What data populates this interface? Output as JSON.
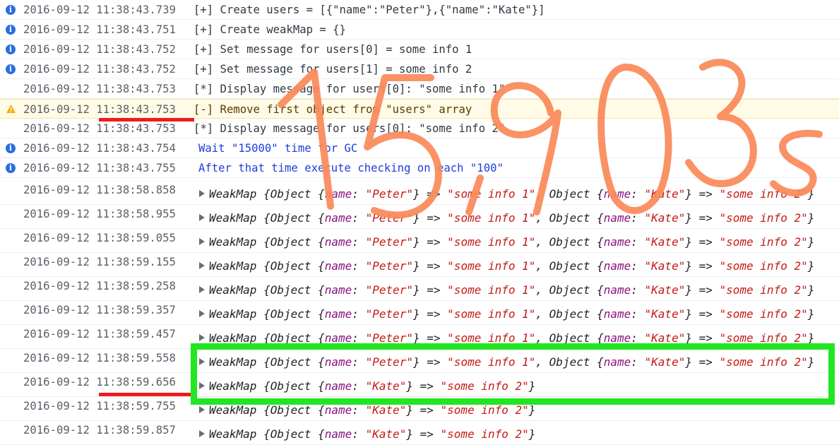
{
  "rows": [
    {
      "icon": "info",
      "ts": "2016-09-12 11:38:43.739",
      "text": "[+] Create users = [{\"name\":\"Peter\"},{\"name\":\"Kate\"}]"
    },
    {
      "icon": "info",
      "ts": "2016-09-12 11:38:43.751",
      "text": "[+] Create weakMap = {}"
    },
    {
      "icon": "info",
      "ts": "2016-09-12 11:38:43.752",
      "text": "[+] Set message for users[0] = some info 1"
    },
    {
      "icon": "info",
      "ts": "2016-09-12 11:38:43.752",
      "text": "[+] Set message for users[1] = some info 2"
    },
    {
      "icon": "",
      "ts": "2016-09-12 11:38:43.753",
      "text": "[*] Display message for users[0]: \"some info 1\""
    },
    {
      "icon": "warning",
      "ts": "2016-09-12 11:38:43.753",
      "text": "[-] Remove first object from \"users\" array"
    },
    {
      "icon": "",
      "ts": "2016-09-12 11:38:43.753",
      "text": "[*] Display message for users[0]: \"some info 2\""
    },
    {
      "icon": "info",
      "ts": "2016-09-12 11:38:43.754",
      "text": "Wait \"15000\" time for GC"
    },
    {
      "icon": "info",
      "ts": "2016-09-12 11:38:43.755",
      "text": "After that time execute checking on each \"100\""
    }
  ],
  "object_rows": [
    {
      "ts": "2016-09-12 11:38:58.858",
      "entries": 2
    },
    {
      "ts": "2016-09-12 11:38:58.955",
      "entries": 2
    },
    {
      "ts": "2016-09-12 11:38:59.055",
      "entries": 2
    },
    {
      "ts": "2016-09-12 11:38:59.155",
      "entries": 2
    },
    {
      "ts": "2016-09-12 11:38:59.258",
      "entries": 2
    },
    {
      "ts": "2016-09-12 11:38:59.357",
      "entries": 2
    },
    {
      "ts": "2016-09-12 11:38:59.457",
      "entries": 2
    },
    {
      "ts": "2016-09-12 11:38:59.558",
      "entries": 2
    },
    {
      "ts": "2016-09-12 11:38:59.656",
      "entries": 1
    },
    {
      "ts": "2016-09-12 11:38:59.755",
      "entries": 1
    },
    {
      "ts": "2016-09-12 11:38:59.857",
      "entries": 1
    }
  ],
  "weakmap": {
    "type": "WeakMap",
    "object": "Object",
    "key": "name",
    "arrow": "=>",
    "entry1_name": "\"Peter\"",
    "entry1_value": "\"some info 1\"",
    "entry2_name": "\"Kate\"",
    "entry2_value": "\"some info 2\""
  },
  "annotation": {
    "handwritten_text": "15,903s",
    "colors": {
      "handwriting": "#fa8a5a",
      "underline": "#ee1c1c",
      "box": "#22e622"
    }
  }
}
